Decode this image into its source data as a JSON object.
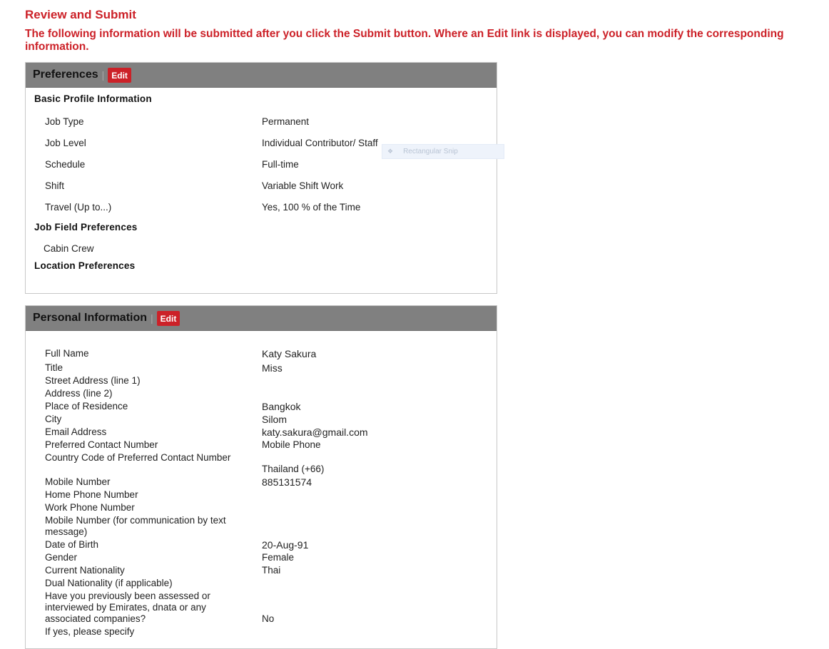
{
  "page": {
    "title": "Review and Submit",
    "intro": "The following information will be submitted after you click the Submit button. Where an Edit link is displayed, you can modify the corresponding information."
  },
  "preferences": {
    "title": "Preferences",
    "edit_label": "Edit",
    "basic_heading": "Basic Profile Information",
    "rows": [
      {
        "label": "Job Type",
        "value": "Permanent"
      },
      {
        "label": "Job Level",
        "value": "Individual Contributor/ Staff"
      },
      {
        "label": "Schedule",
        "value": "Full-time"
      },
      {
        "label": "Shift",
        "value": "Variable Shift Work"
      },
      {
        "label": "Travel (Up to...)",
        "value": "Yes, 100 % of the Time"
      }
    ],
    "job_field_heading": "Job Field Preferences",
    "job_fields": [
      "Cabin Crew"
    ],
    "location_heading": "Location Preferences"
  },
  "personal": {
    "title": "Personal Information",
    "edit_label": "Edit",
    "rows": [
      {
        "label": "Full Name",
        "value": "Katy Sakura"
      },
      {
        "label": "Title",
        "value": "Miss"
      },
      {
        "label": "Street Address (line 1)",
        "value": ""
      },
      {
        "label": "Address (line 2)",
        "value": ""
      },
      {
        "label": "Place of Residence",
        "value": "Bangkok"
      },
      {
        "label": "City",
        "value": "Silom"
      },
      {
        "label": "Email Address",
        "value": "katy.sakura@gmail.com"
      },
      {
        "label": "Preferred Contact Number",
        "value": "Mobile Phone"
      },
      {
        "label": "Country Code of Preferred Contact Number",
        "value": "Thailand (+66)"
      },
      {
        "label": "Mobile Number",
        "value": "885131574"
      },
      {
        "label": "Home Phone Number",
        "value": ""
      },
      {
        "label": "Work Phone Number",
        "value": ""
      },
      {
        "label": "Mobile Number (for communication by text message)",
        "value": ""
      },
      {
        "label": "Date of Birth",
        "value": "20-Aug-91"
      },
      {
        "label": "Gender",
        "value": "Female"
      },
      {
        "label": "Current Nationality",
        "value": "Thai"
      },
      {
        "label": "Dual Nationality (if applicable)",
        "value": ""
      },
      {
        "label": "Have you previously been assessed or interviewed by Emirates, dnata or any associated companies?",
        "value": "No"
      },
      {
        "label": "If yes, please specify",
        "value": ""
      }
    ]
  },
  "overlay": {
    "snip_label": "Rectangular Snip",
    "snip_icon": "snip-icon"
  },
  "colors": {
    "accent": "#cc2128",
    "panel_header": "#808080"
  }
}
